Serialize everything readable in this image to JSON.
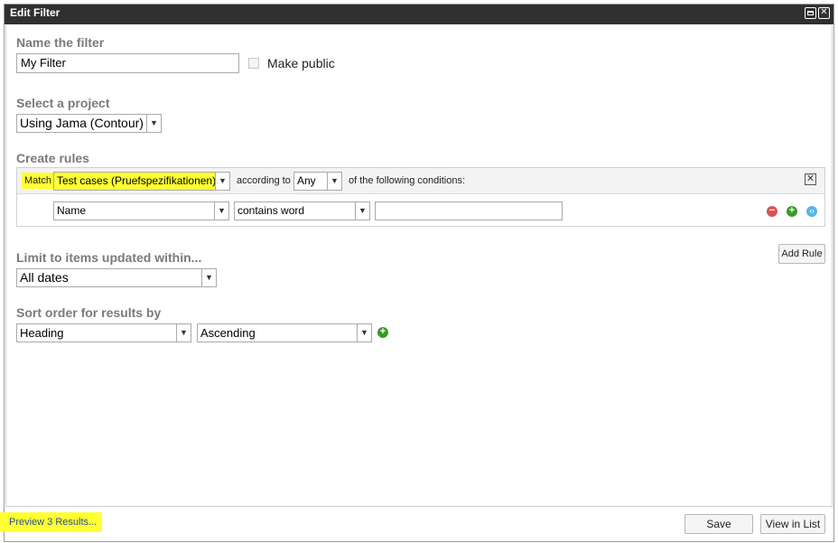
{
  "window": {
    "title": "Edit Filter"
  },
  "name_section": {
    "label": "Name the filter",
    "filter_name_value": "My Filter",
    "make_public_label": "Make public"
  },
  "project_section": {
    "label": "Select a project",
    "selected_project": "Using Jama (Contour)"
  },
  "rules_section": {
    "label": "Create rules",
    "match_label": "Match",
    "item_type_value": "Test cases (Pruefspezifikationen)",
    "according_to_label": "according to",
    "any_value": "Any",
    "conditions_label": "of the following conditions:",
    "rule": {
      "field_value": "Name",
      "operator_value": "contains word",
      "value_text": ""
    },
    "add_rule_label": "Add Rule"
  },
  "limit_section": {
    "label": "Limit to items updated within...",
    "selected_range": "All dates"
  },
  "sort_section": {
    "label": "Sort order for results by",
    "sort_field_value": "Heading",
    "sort_direction_value": "Ascending"
  },
  "footer": {
    "preview_label": "Preview 3 Results...",
    "save_label": "Save",
    "view_in_list_label": "View in List"
  },
  "colors": {
    "titlebar": "#303030",
    "highlight": "#ffff33",
    "remove_icon": "#e05050",
    "add_icon": "#3a9a2a",
    "info_icon": "#55b6e6"
  }
}
